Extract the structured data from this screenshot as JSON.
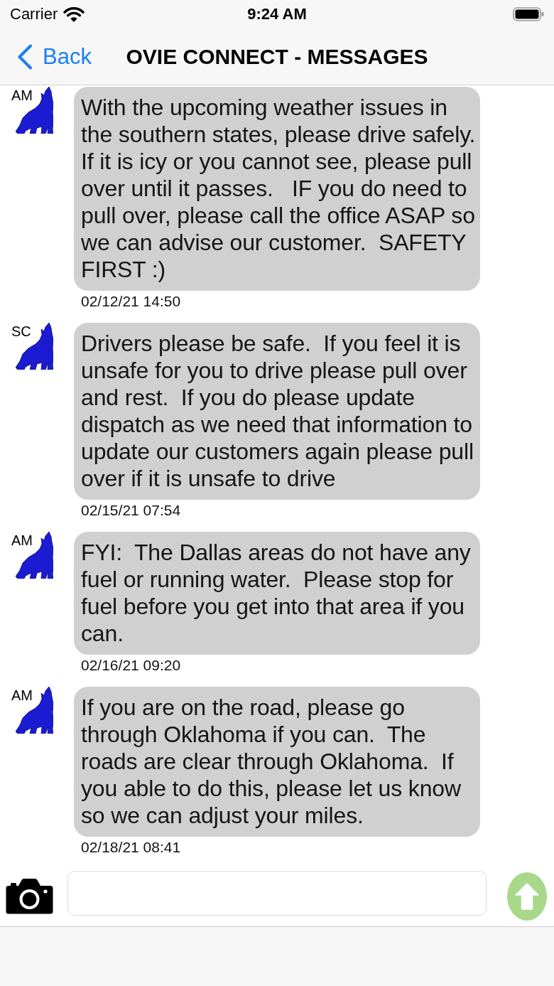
{
  "status_bar": {
    "carrier": "Carrier",
    "time": "9:24 AM"
  },
  "nav_bar": {
    "back": "Back",
    "title": "OVIE CONNECT - MESSAGES"
  },
  "messages": [
    {
      "sender": "AM",
      "text": "With the upcoming weather issues in the southern states, please drive safely.  If it is icy or you cannot see, please pull over until it passes.   IF you do need to pull over, please call the office ASAP so we can advise our customer.  SAFETY FIRST :)",
      "timestamp": "02/12/21 14:50"
    },
    {
      "sender": "SC",
      "text": "Drivers please be safe.  If you feel it is unsafe for you to drive please pull over and rest.  If you do please update dispatch as we need that information to update our customers again please pull over if it is unsafe to drive",
      "timestamp": "02/15/21 07:54"
    },
    {
      "sender": "AM",
      "text": "FYI:  The Dallas areas do not have any fuel or running water.  Please stop for fuel before you get into that area if you can.",
      "timestamp": "02/16/21 09:20"
    },
    {
      "sender": "AM",
      "text": "If you are on the road, please go through Oklahoma if you can.  The roads are clear through Oklahoma.  If you able to do this, please let us know so we can adjust your miles.",
      "timestamp": "02/18/21 08:41"
    }
  ]
}
